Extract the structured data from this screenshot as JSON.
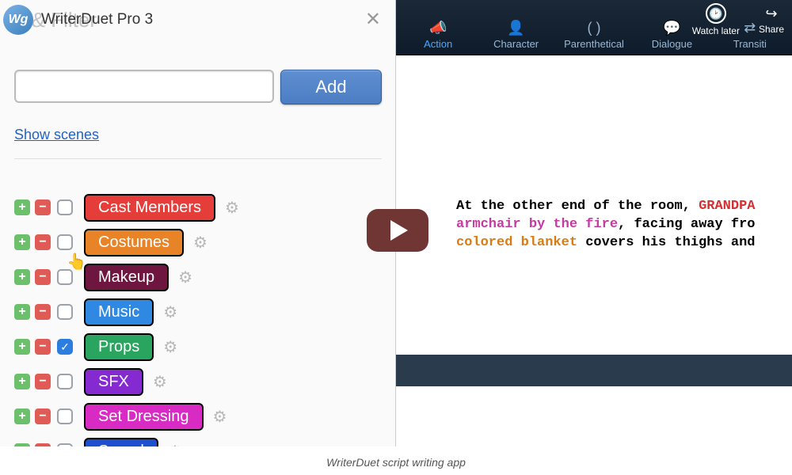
{
  "app": {
    "logo_text": "Wg",
    "title": "WriterDuet Pro 3"
  },
  "panel": {
    "header_ghost": "g & Filter",
    "close_glyph": "✕",
    "add_button": "Add",
    "show_scenes": "Show scenes"
  },
  "tags": [
    {
      "label": "Cast Members",
      "color": "#e43d3a",
      "checked": false
    },
    {
      "label": "Costumes",
      "color": "#e98328",
      "checked": false
    },
    {
      "label": "Makeup",
      "color": "#6e1640",
      "checked": false
    },
    {
      "label": "Music",
      "color": "#2f89e3",
      "checked": false
    },
    {
      "label": "Props",
      "color": "#2aa560",
      "checked": true
    },
    {
      "label": "SFX",
      "color": "#8529d1",
      "checked": false
    },
    {
      "label": "Set Dressing",
      "color": "#d82bc4",
      "checked": false
    },
    {
      "label": "Sound",
      "color": "#1d4fd1",
      "checked": false
    }
  ],
  "toolbar": {
    "items": [
      {
        "name": "action",
        "icon": "📣",
        "label": "Action",
        "active": true
      },
      {
        "name": "character",
        "icon": "👤",
        "label": "Character",
        "active": false
      },
      {
        "name": "parenthetical",
        "icon": "( )",
        "label": "Parenthetical",
        "active": false
      },
      {
        "name": "dialogue",
        "icon": "💬",
        "label": "Dialogue",
        "active": false
      },
      {
        "name": "transition",
        "icon": "⇄",
        "label": "Transiti",
        "active": false
      }
    ],
    "watch_later": "Watch later",
    "share": "Share"
  },
  "script": {
    "line1_a": "At the other end of the room, ",
    "line1_b": "GRANDPA",
    "line2_a": "armchair by the fire",
    "line2_b": ", facing away fro",
    "line3_a": "colored blanket",
    "line3_b": " covers his thighs and"
  },
  "caption": "WriterDuet script writing app"
}
